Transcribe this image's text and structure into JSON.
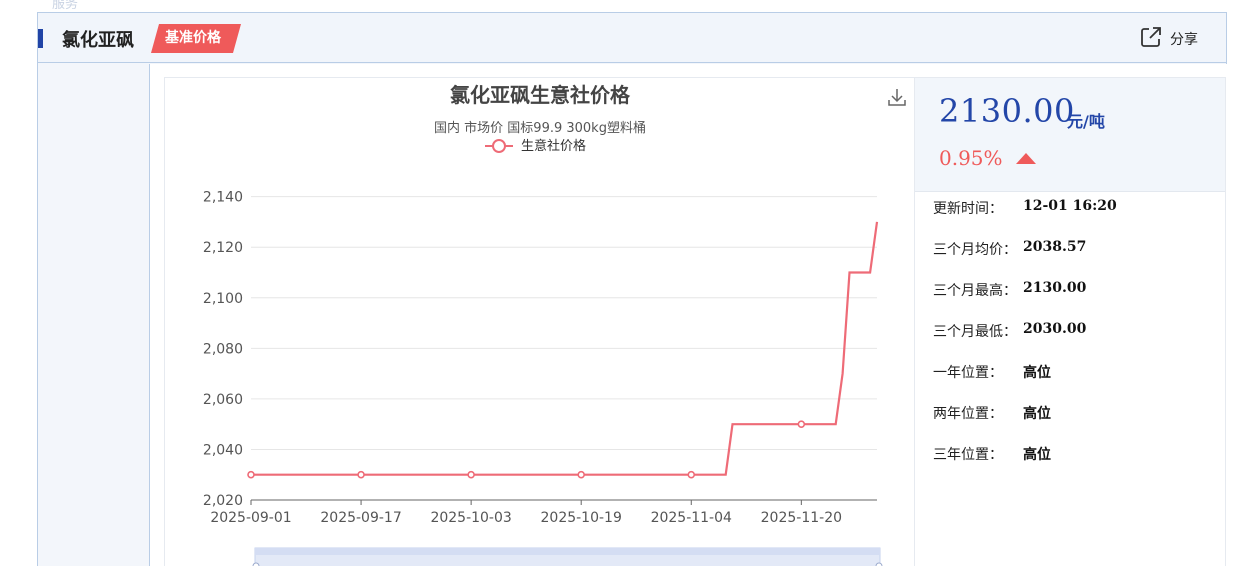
{
  "faint_top_text": "服务",
  "header": {
    "product_name": "氯化亚砜",
    "badge": "基准价格",
    "share_label": "分享"
  },
  "icons": {
    "share": "share-icon",
    "download": "download-icon"
  },
  "colors": {
    "accent_blue": "#2346a8",
    "badge_red": "#ef5a5a",
    "line_red": "#ee6b77"
  },
  "price": {
    "value": "2130.00",
    "unit": "元/吨",
    "change": "0.95%"
  },
  "stats": [
    {
      "label": "更新时间：",
      "value": "12-01 16:20"
    },
    {
      "label": "三个月均价：",
      "value": "2038.57"
    },
    {
      "label": "三个月最高：",
      "value": "2130.00"
    },
    {
      "label": "三个月最低：",
      "value": "2030.00"
    },
    {
      "label": "一年位置：",
      "value": "高位"
    },
    {
      "label": "两年位置：",
      "value": "高位"
    },
    {
      "label": "三年位置：",
      "value": "高位"
    }
  ],
  "chart_data": {
    "type": "line",
    "title": "氯化亚砜生意社价格",
    "subtitle": "国内 市场价 国标99.9  300kg塑料桶",
    "legend_position": "top-center",
    "series": [
      {
        "name": "生意社价格",
        "step": true,
        "points": [
          {
            "x": "2025-09-01",
            "y": 2030
          },
          {
            "x": "2025-09-17",
            "y": 2030
          },
          {
            "x": "2025-10-03",
            "y": 2030
          },
          {
            "x": "2025-10-19",
            "y": 2030
          },
          {
            "x": "2025-11-04",
            "y": 2030
          },
          {
            "x": "2025-11-09",
            "y": 2030
          },
          {
            "x": "2025-11-10",
            "y": 2050
          },
          {
            "x": "2025-11-20",
            "y": 2050
          },
          {
            "x": "2025-11-25",
            "y": 2050
          },
          {
            "x": "2025-11-26",
            "y": 2070
          },
          {
            "x": "2025-11-27",
            "y": 2110
          },
          {
            "x": "2025-11-30",
            "y": 2110
          },
          {
            "x": "2025-12-01",
            "y": 2130
          }
        ],
        "markers": [
          "2025-09-01",
          "2025-09-17",
          "2025-10-03",
          "2025-10-19",
          "2025-11-04",
          "2025-11-20"
        ]
      }
    ],
    "x_ticks": [
      "2025-09-01",
      "2025-09-17",
      "2025-10-03",
      "2025-10-19",
      "2025-11-04",
      "2025-11-20"
    ],
    "y_ticks": [
      2020,
      2040,
      2060,
      2080,
      2100,
      2120,
      2140
    ],
    "xlim": [
      "2025-09-01",
      "2025-12-01"
    ],
    "ylim": [
      2020,
      2145
    ],
    "grid": true
  }
}
